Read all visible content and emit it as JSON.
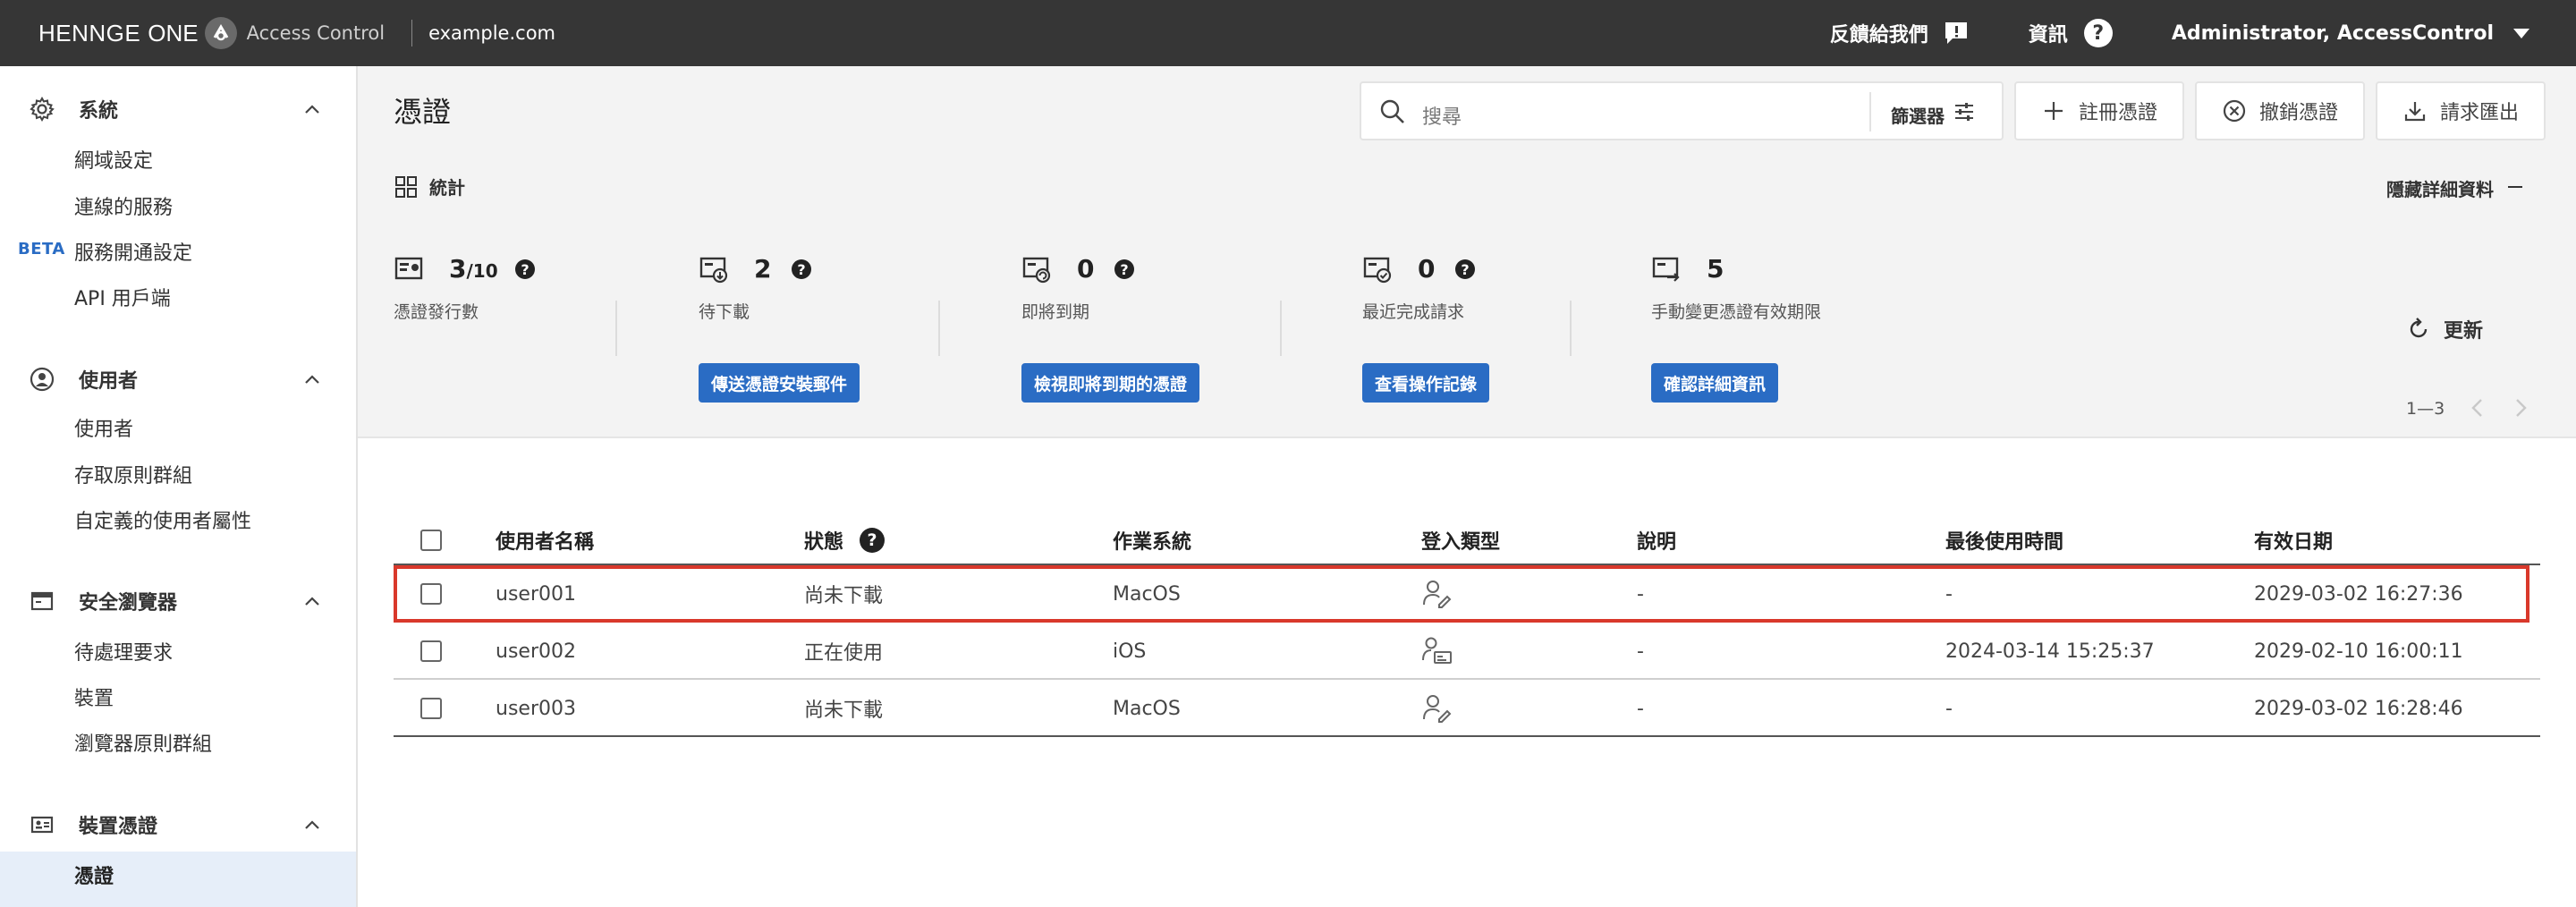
{
  "header": {
    "brand_henn": "HENNGE",
    "brand_one": "ONE",
    "product": "Access Control",
    "domain": "example.com",
    "feedback": "反饋給我們",
    "info": "資訊",
    "user": "Administrator, AccessControl"
  },
  "sidebar": {
    "sections": [
      {
        "title": "系統",
        "icon": "gear-icon",
        "items": [
          "網域設定",
          "連線的服務",
          "服務開通設定",
          "API 用戶端"
        ],
        "beta_label": "BETA"
      },
      {
        "title": "使用者",
        "icon": "user-circle-icon",
        "items": [
          "使用者",
          "存取原則群組",
          "自定義的使用者屬性"
        ]
      },
      {
        "title": "安全瀏覽器",
        "icon": "browser-icon",
        "items": [
          "待處理要求",
          "裝置",
          "瀏覽器原則群組"
        ]
      },
      {
        "title": "裝置憑證",
        "icon": "id-card-icon",
        "items": [
          "憑證"
        ]
      }
    ],
    "active": "憑證"
  },
  "main": {
    "title": "憑證",
    "search_placeholder": "搜尋",
    "filter_label": "篩選器",
    "buttons": {
      "register": "註冊憑證",
      "revoke": "撤銷憑證",
      "export": "請求匯出"
    },
    "stats_label": "統計",
    "hide_details": "隱藏詳細資料",
    "refresh": "更新",
    "stats": [
      {
        "value": "3",
        "total": "/10",
        "label": "憑證發行數",
        "help": "?"
      },
      {
        "value": "2",
        "label": "待下載",
        "help": "?",
        "button": "傳送憑證安裝郵件"
      },
      {
        "value": "0",
        "label": "即將到期",
        "help": "?",
        "button": "檢視即將到期的憑證"
      },
      {
        "value": "0",
        "label": "最近完成請求",
        "help": "?",
        "button": "查看操作記錄"
      },
      {
        "value": "5",
        "label": "手動變更憑證有效期限",
        "button": "確認詳細資訊"
      }
    ],
    "pagination": "1—3"
  },
  "table": {
    "columns": [
      "使用者名稱",
      "狀態",
      "作業系統",
      "登入類型",
      "說明",
      "最後使用時間",
      "有效日期"
    ],
    "status_help": "?",
    "rows": [
      {
        "user": "user001",
        "status": "尚未下載",
        "os": "MacOS",
        "login_icon": "user-edit-icon",
        "desc": "-",
        "last_used": "-",
        "expires": "2029-03-02 16:27:36"
      },
      {
        "user": "user002",
        "status": "正在使用",
        "os": "iOS",
        "login_icon": "user-card-icon",
        "desc": "-",
        "last_used": "2024-03-14 15:25:37",
        "expires": "2029-02-10 16:00:11"
      },
      {
        "user": "user003",
        "status": "尚未下載",
        "os": "MacOS",
        "login_icon": "user-edit-icon",
        "desc": "-",
        "last_used": "-",
        "expires": "2029-03-02 16:28:46"
      }
    ]
  },
  "colors": {
    "topbar": "#363636",
    "accent": "#2a6cc4",
    "highlight": "#d9382b",
    "panel": "#f3f3f3"
  }
}
